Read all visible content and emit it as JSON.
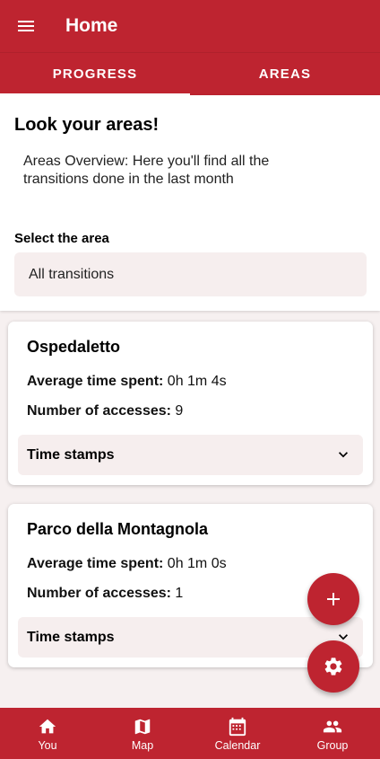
{
  "appbar": {
    "title": "Home",
    "menu_icon": "menu-icon"
  },
  "tabs": [
    {
      "label": "PROGRESS",
      "active": true
    },
    {
      "label": "AREAS",
      "active": false
    }
  ],
  "header": {
    "title": "Look your areas!",
    "description": "Areas Overview: Here you'll find all the transitions done in the last month",
    "select_label": "Select the area",
    "select_value": "All transitions"
  },
  "cards": [
    {
      "name": "Ospedaletto",
      "time_label": "Average time spent:",
      "time_value": " 0h 1m 4s",
      "access_label": "Number of accesses:",
      "access_value": " 9",
      "expander_label": "Time stamps"
    },
    {
      "name": "Parco della Montagnola",
      "time_label": "Average time spent:",
      "time_value": " 0h 1m 0s",
      "access_label": "Number of accesses:",
      "access_value": " 1",
      "expander_label": "Time stamps"
    }
  ],
  "fabs": {
    "add_icon": "plus-icon",
    "settings_icon": "gear-icon"
  },
  "bottom_nav": [
    {
      "label": "You",
      "icon": "home-icon"
    },
    {
      "label": "Map",
      "icon": "map-icon"
    },
    {
      "label": "Calendar",
      "icon": "calendar-icon"
    },
    {
      "label": "Group",
      "icon": "group-icon"
    }
  ],
  "colors": {
    "primary": "#be2430",
    "surface": "#ffffff",
    "background": "#f6f0f0",
    "field": "#f6eeee"
  }
}
